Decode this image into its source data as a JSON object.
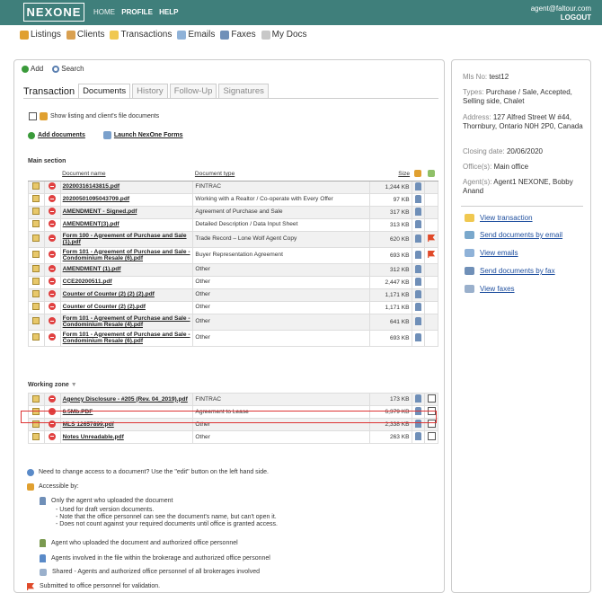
{
  "header": {
    "logo": "NEXONE",
    "nav": [
      "HOME",
      "PROFILE",
      "HELP"
    ],
    "user_email": "agent@faltour.com",
    "logout": "LOGOUT"
  },
  "mainnav": [
    {
      "label": "Listings",
      "icon": "house-icon"
    },
    {
      "label": "Clients",
      "icon": "people-icon"
    },
    {
      "label": "Transactions",
      "icon": "folder-icon"
    },
    {
      "label": "Emails",
      "icon": "envelope-icon"
    },
    {
      "label": "Faxes",
      "icon": "fax-icon"
    },
    {
      "label": "My Docs",
      "icon": "docs-icon"
    }
  ],
  "toolbar": {
    "add": "Add",
    "search": "Search"
  },
  "transaction": {
    "title": "Transaction",
    "tabs": [
      "Documents",
      "History",
      "Follow-Up",
      "Signatures"
    ],
    "show_checkbox_label": "Show listing and client's file documents",
    "add_documents": "Add documents",
    "launch_forms": "Launch NexOne Forms"
  },
  "main_section": {
    "title": "Main section",
    "headers": {
      "name": "Document name",
      "type": "Document type",
      "size": "Size"
    },
    "rows": [
      {
        "name": "20200316143815.pdf",
        "type": "FINTRAC",
        "size": "1,244 KB"
      },
      {
        "name": "20200501095043709.pdf",
        "type": "Working with a Realtor / Co-operate with Every Offer",
        "size": "97 KB"
      },
      {
        "name": "AMENDMENT - Signed.pdf",
        "type": "Agreement of Purchase and Sale",
        "size": "317 KB"
      },
      {
        "name": "AMENDMENT(3).pdf",
        "type": "Detailed Description / Data Input Sheet",
        "size": "313 KB"
      },
      {
        "name": "Form 100 - Agreement of Purchase and Sale (1).pdf",
        "type": "Trade Record – Lone Wolf Agent Copy",
        "size": "620 KB",
        "flag": true
      },
      {
        "name": "Form 101 - Agreement of Purchase and Sale - Condominium Resale (6).pdf",
        "type": "Buyer Representation Agreement",
        "size": "693 KB",
        "flag": true
      },
      {
        "name": "AMENDMENT (1).pdf",
        "type": "Other",
        "size": "312 KB"
      },
      {
        "name": "CCE20200511.pdf",
        "type": "Other",
        "size": "2,447 KB"
      },
      {
        "name": "Counter of Counter (2) (2) (2).pdf",
        "type": "Other",
        "size": "1,171 KB"
      },
      {
        "name": "Counter of Counter (2) (2).pdf",
        "type": "Other",
        "size": "1,171 KB"
      },
      {
        "name": "Form 101 - Agreement of Purchase and Sale - Condominium Resale (4).pdf",
        "type": "Other",
        "size": "641 KB"
      },
      {
        "name": "Form 101 - Agreement of Purchase and Sale - Condominium Resale (6).pdf",
        "type": "Other",
        "size": "693 KB"
      }
    ]
  },
  "working_zone": {
    "title": "Working zone",
    "rows": [
      {
        "name": "Agency Disclosure - #205 (Rev. 04_2019).pdf",
        "type": "FINTRAC",
        "size": "173 KB"
      },
      {
        "name": "6.5Mb.PDF",
        "type": "Agreement to Lease",
        "size": "6,379 KB"
      },
      {
        "name": "MLS 12657899.pdf",
        "type": "Other",
        "size": "2,338 KB"
      },
      {
        "name": "Notes Unreadable.pdf",
        "type": "Other",
        "size": "263 KB"
      }
    ]
  },
  "legend": {
    "help": "Need to change access to a document? Use the \"edit\" button on the left hand side.",
    "accessible_by": "Accessible by:",
    "only_agent": "Only the agent who uploaded the document",
    "notes": [
      "- Used for draft version documents.",
      "- Note that the office personnel can see the document's name, but can't open it.",
      "- Does not count against your required documents until office is granted access."
    ],
    "agent_office": "Agent who uploaded the document and authorized office personnel",
    "agents_file": "Agents involved in the file within the brokerage and authorized office personnel",
    "shared": "Shared - Agents and authorized office personnel of all brokerages involved",
    "submitted": "Submitted to office personnel for validation."
  },
  "side": {
    "mls": {
      "label": "Mls No:",
      "value": "test12"
    },
    "types": {
      "label": "Types:",
      "value": "Purchase / Sale, Accepted, Selling side, Chalet"
    },
    "address": {
      "label": "Address:",
      "value": "127 Alfred Street W #44, Thornbury, Ontario N0H 2P0, Canada"
    },
    "closing": {
      "label": "Closing date:",
      "value": "20/06/2020"
    },
    "offices": {
      "label": "Office(s):",
      "value": "Main office"
    },
    "agents": {
      "label": "Agent(s):",
      "value": "Agent1 NEXONE, Bobby Anand"
    },
    "actions": [
      "View transaction",
      "Send documents by email",
      "View emails",
      "Send documents by fax",
      "View faxes"
    ]
  },
  "colors": {
    "topbar": "#3f7f7b",
    "link": "#1e4e9e",
    "highlight": "#dd3333"
  }
}
